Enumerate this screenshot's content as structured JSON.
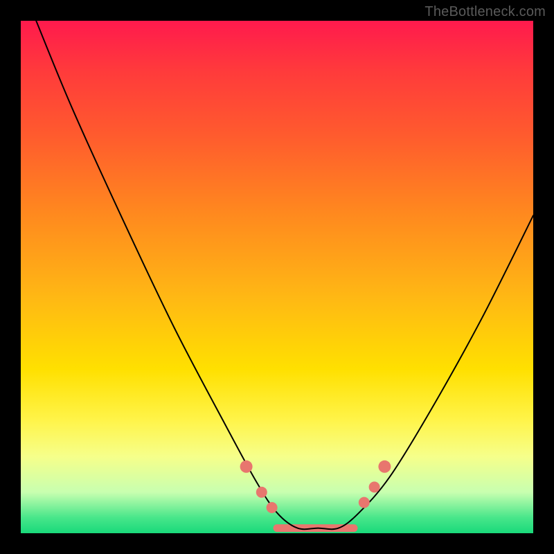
{
  "watermark": {
    "text": "TheBottleneck.com"
  },
  "chart_data": {
    "type": "line",
    "title": "",
    "xlabel": "",
    "ylabel": "",
    "xlim": [
      0,
      100
    ],
    "ylim": [
      0,
      100
    ],
    "series": [
      {
        "name": "curve",
        "x": [
          3,
          10,
          20,
          30,
          40,
          46,
          50,
          54,
          58,
          62,
          66,
          72,
          80,
          90,
          100
        ],
        "y": [
          100,
          83,
          61,
          40,
          21,
          10,
          4,
          1,
          1,
          1,
          4,
          11,
          24,
          42,
          62
        ],
        "color": "#000000",
        "line_width": 2
      }
    ],
    "markers": [
      {
        "name": "left-dot-1",
        "x": 44,
        "y": 13,
        "color": "#e8766e",
        "r": 9
      },
      {
        "name": "left-dot-2",
        "x": 47,
        "y": 8,
        "color": "#e8766e",
        "r": 8
      },
      {
        "name": "left-dot-3",
        "x": 49,
        "y": 5,
        "color": "#e8766e",
        "r": 8
      },
      {
        "name": "right-dot-1",
        "x": 67,
        "y": 6,
        "color": "#e8766e",
        "r": 8
      },
      {
        "name": "right-dot-2",
        "x": 69,
        "y": 9,
        "color": "#e8766e",
        "r": 8
      },
      {
        "name": "right-dot-3",
        "x": 71,
        "y": 13,
        "color": "#e8766e",
        "r": 9
      }
    ],
    "bottom_band": {
      "x0": 50,
      "x1": 65,
      "y": 1,
      "color": "#e8766e",
      "thickness": 11
    }
  }
}
